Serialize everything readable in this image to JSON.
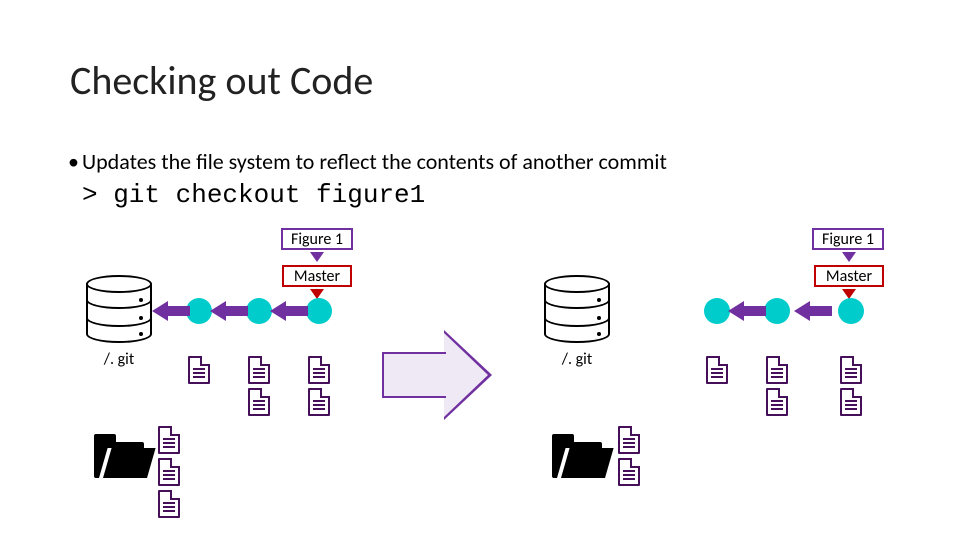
{
  "title": "Checking out Code",
  "bullet": "Updates the file system to reflect the contents of another commit",
  "command": "> git checkout figure1",
  "tags": {
    "figure1": "Figure 1",
    "master": "Master"
  },
  "labels": {
    "gitdir": "/. git"
  },
  "colors": {
    "figure1_border": "#7030a0",
    "master_border": "#c00000",
    "commit": "#00cccc",
    "arrow": "#7030a0"
  }
}
